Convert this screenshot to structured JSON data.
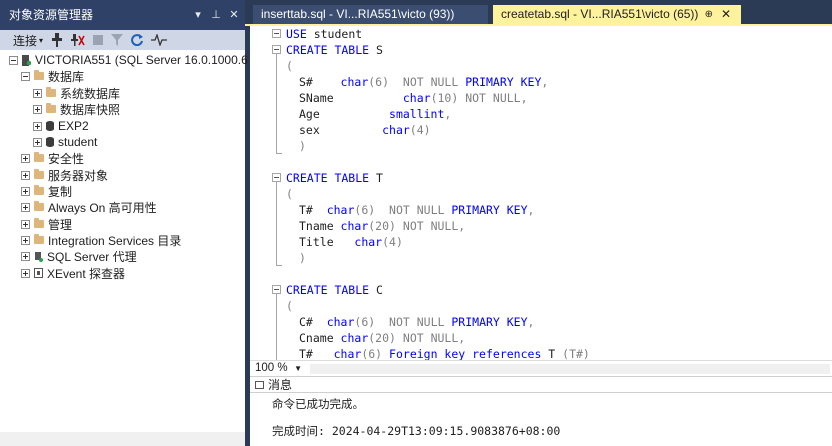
{
  "object_explorer": {
    "title": "对象资源管理器",
    "title_buttons": [
      "▾",
      "⊥",
      "✕"
    ],
    "toolbar": {
      "connect_label": "连接"
    },
    "tree": [
      {
        "label": "VICTORIA551 (SQL Server 16.0.1000.6",
        "level": 0,
        "expanded": true,
        "icon": "server-icon"
      },
      {
        "label": "数据库",
        "level": 1,
        "expanded": true,
        "icon": "folder-icon"
      },
      {
        "label": "系统数据库",
        "level": 2,
        "expanded": false,
        "icon": "folder-icon"
      },
      {
        "label": "数据库快照",
        "level": 2,
        "expanded": false,
        "icon": "folder-icon"
      },
      {
        "label": "EXP2",
        "level": 2,
        "expanded": false,
        "icon": "database-icon"
      },
      {
        "label": "student",
        "level": 2,
        "expanded": false,
        "icon": "database-icon"
      },
      {
        "label": "安全性",
        "level": 1,
        "expanded": false,
        "icon": "folder-icon"
      },
      {
        "label": "服务器对象",
        "level": 1,
        "expanded": false,
        "icon": "folder-icon"
      },
      {
        "label": "复制",
        "level": 1,
        "expanded": false,
        "icon": "folder-icon"
      },
      {
        "label": "Always On 高可用性",
        "level": 1,
        "expanded": false,
        "icon": "folder-icon"
      },
      {
        "label": "管理",
        "level": 1,
        "expanded": false,
        "icon": "folder-icon"
      },
      {
        "label": "Integration Services 目录",
        "level": 1,
        "expanded": false,
        "icon": "folder-icon"
      },
      {
        "label": "SQL Server 代理",
        "level": 1,
        "expanded": false,
        "icon": "agent-icon"
      },
      {
        "label": "XEvent 探查器",
        "level": 1,
        "expanded": false,
        "icon": "xevent-icon"
      }
    ]
  },
  "tabs": [
    {
      "label": "inserttab.sql - VI...RIA551\\victo (93))",
      "active": false
    },
    {
      "label": "createtab.sql - VI...RIA551\\victo (65))",
      "active": true,
      "pin": "⊕",
      "close": "✕"
    }
  ],
  "editor": {
    "lines": [
      [
        [
          "kw",
          "USE"
        ],
        [
          "t",
          " student"
        ]
      ],
      [
        [
          "kw",
          "CREATE TABLE"
        ],
        [
          "t",
          " S"
        ]
      ],
      [
        [
          "gr",
          "("
        ]
      ],
      [
        [
          "t",
          "S#    "
        ],
        [
          "ty",
          "char"
        ],
        [
          "gr",
          "(6)"
        ],
        [
          "t",
          "  "
        ],
        [
          "gr",
          "NOT NULL"
        ],
        [
          "t",
          " "
        ],
        [
          "kw",
          "PRIMARY KEY"
        ],
        [
          "gr",
          ","
        ]
      ],
      [
        [
          "t",
          "SName          "
        ],
        [
          "ty",
          "char"
        ],
        [
          "gr",
          "(10)"
        ],
        [
          "t",
          " "
        ],
        [
          "gr",
          "NOT NULL"
        ],
        [
          "gr",
          ","
        ]
      ],
      [
        [
          "t",
          "Age          "
        ],
        [
          "ty",
          "smallint"
        ],
        [
          "gr",
          ","
        ]
      ],
      [
        [
          "t",
          "sex         "
        ],
        [
          "ty",
          "char"
        ],
        [
          "gr",
          "(4)"
        ]
      ],
      [
        [
          "gr",
          ")"
        ]
      ],
      [
        [
          "t",
          ""
        ]
      ],
      [
        [
          "kw",
          "CREATE TABLE"
        ],
        [
          "t",
          " T"
        ]
      ],
      [
        [
          "gr",
          "("
        ]
      ],
      [
        [
          "t",
          "T#  "
        ],
        [
          "ty",
          "char"
        ],
        [
          "gr",
          "(6)"
        ],
        [
          "t",
          "  "
        ],
        [
          "gr",
          "NOT NULL"
        ],
        [
          "t",
          " "
        ],
        [
          "kw",
          "PRIMARY KEY"
        ],
        [
          "gr",
          ","
        ]
      ],
      [
        [
          "t",
          "Tname "
        ],
        [
          "ty",
          "char"
        ],
        [
          "gr",
          "(20)"
        ],
        [
          "t",
          " "
        ],
        [
          "gr",
          "NOT NULL"
        ],
        [
          "gr",
          ","
        ]
      ],
      [
        [
          "t",
          "Title   "
        ],
        [
          "ty",
          "char"
        ],
        [
          "gr",
          "(4)"
        ]
      ],
      [
        [
          "gr",
          ")"
        ]
      ],
      [
        [
          "t",
          ""
        ]
      ],
      [
        [
          "kw",
          "CREATE TABLE"
        ],
        [
          "t",
          " C"
        ]
      ],
      [
        [
          "gr",
          "("
        ]
      ],
      [
        [
          "t",
          "C#  "
        ],
        [
          "ty",
          "char"
        ],
        [
          "gr",
          "(6)"
        ],
        [
          "t",
          "  "
        ],
        [
          "gr",
          "NOT NULL"
        ],
        [
          "t",
          " "
        ],
        [
          "kw",
          "PRIMARY KEY"
        ],
        [
          "gr",
          ","
        ]
      ],
      [
        [
          "t",
          "Cname "
        ],
        [
          "ty",
          "char"
        ],
        [
          "gr",
          "(20)"
        ],
        [
          "t",
          " "
        ],
        [
          "gr",
          "NOT NULL"
        ],
        [
          "gr",
          ","
        ]
      ],
      [
        [
          "t",
          "T#   "
        ],
        [
          "ty",
          "char"
        ],
        [
          "gr",
          "(6)"
        ],
        [
          "t",
          " "
        ],
        [
          "kw",
          "Foreign key references"
        ],
        [
          "t",
          " T "
        ],
        [
          "gr",
          "(T#)"
        ]
      ]
    ]
  },
  "zoom": {
    "value": "100 %"
  },
  "results": {
    "tab_label": "消息",
    "messages": [
      "命令已成功完成。",
      "完成时间: 2024-04-29T13:09:15.9083876+08:00"
    ]
  },
  "colors": {
    "chrome": "#2b3a55",
    "active_tab": "#fff29d",
    "keyword": "#0000ff",
    "gray": "#808080"
  }
}
